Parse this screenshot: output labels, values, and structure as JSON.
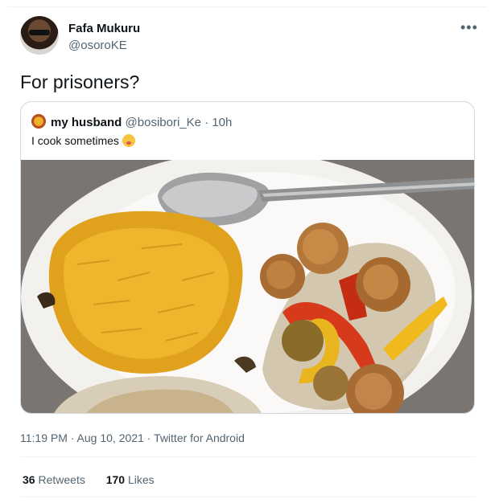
{
  "author": {
    "display_name": "Fafa Mukuru",
    "handle": "@osoroKE"
  },
  "menu": {
    "more_glyph": "•••"
  },
  "tweet": {
    "text": "For prisoners?"
  },
  "quoted": {
    "display_name": "my husband",
    "handle": "@bosibori_Ke",
    "separator": "·",
    "time": "10h",
    "text": "I cook sometimes",
    "emoji_icon": "kissing-face-icon"
  },
  "meta": {
    "timestamp": "11:19 PM · Aug 10, 2021 · Twitter for Android"
  },
  "stats": {
    "retweets_count": "36",
    "retweets_label": "Retweets",
    "likes_count": "170",
    "likes_label": "Likes"
  },
  "colors": {
    "text": "#0f1419",
    "secondary": "#536471",
    "border": "#cfd9de"
  }
}
